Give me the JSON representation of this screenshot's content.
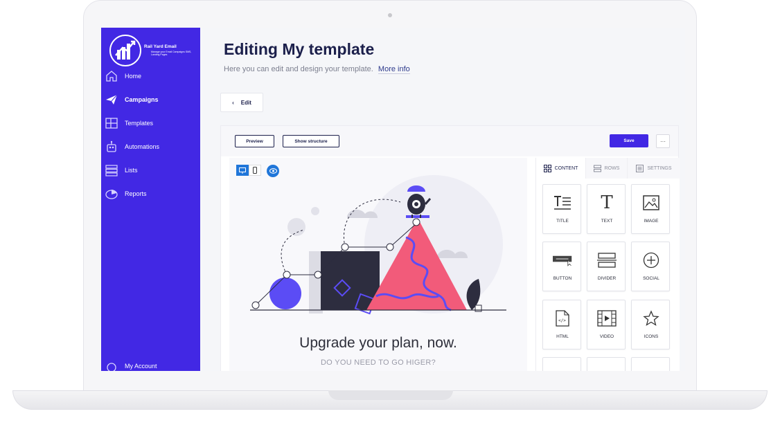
{
  "brand": {
    "name": "Rail Yard Email",
    "tagline": "Manage your Email Campaigns SMS, Landing Pages"
  },
  "sidebar": {
    "items": [
      {
        "label": "Home",
        "icon": "home-icon"
      },
      {
        "label": "Campaigns",
        "icon": "paper-plane-icon",
        "active": true
      },
      {
        "label": "Templates",
        "icon": "layout-icon"
      },
      {
        "label": "Automations",
        "icon": "robot-icon"
      },
      {
        "label": "Lists",
        "icon": "list-icon"
      },
      {
        "label": "Reports",
        "icon": "pie-chart-icon"
      }
    ],
    "account_label": "My Account"
  },
  "header": {
    "title": "Editing My template",
    "subtitle": "Here you can edit and design your template.",
    "more_info": "More info"
  },
  "back_button": {
    "label": "Edit"
  },
  "toolbar": {
    "preview_label": "Preview",
    "structure_label": "Show structure",
    "save_label": "Save",
    "more_label": "···"
  },
  "canvas": {
    "headline": "Upgrade your plan, now.",
    "subheadline": "DO YOU NEED TO GO HIGER?"
  },
  "panel": {
    "tabs": [
      {
        "label": "CONTENT",
        "active": true
      },
      {
        "label": "ROWS"
      },
      {
        "label": "SETTINGS"
      }
    ],
    "blocks": [
      {
        "label": "TITLE",
        "icon": "title-icon"
      },
      {
        "label": "TEXT",
        "icon": "text-icon"
      },
      {
        "label": "IMAGE",
        "icon": "image-icon"
      },
      {
        "label": "BUTTON",
        "icon": "button-icon"
      },
      {
        "label": "DIVIDER",
        "icon": "divider-icon"
      },
      {
        "label": "SOCIAL",
        "icon": "plus-circle-icon"
      },
      {
        "label": "HTML",
        "icon": "html-file-icon"
      },
      {
        "label": "VIDEO",
        "icon": "video-icon"
      },
      {
        "label": "ICONS",
        "icon": "star-icon"
      }
    ]
  },
  "colors": {
    "accent": "#4228e4",
    "heading": "#1b1f4b",
    "illustration_pink": "#f25b7a",
    "illustration_dark": "#2d2d3f",
    "illustration_purple": "#5b4cf5"
  }
}
